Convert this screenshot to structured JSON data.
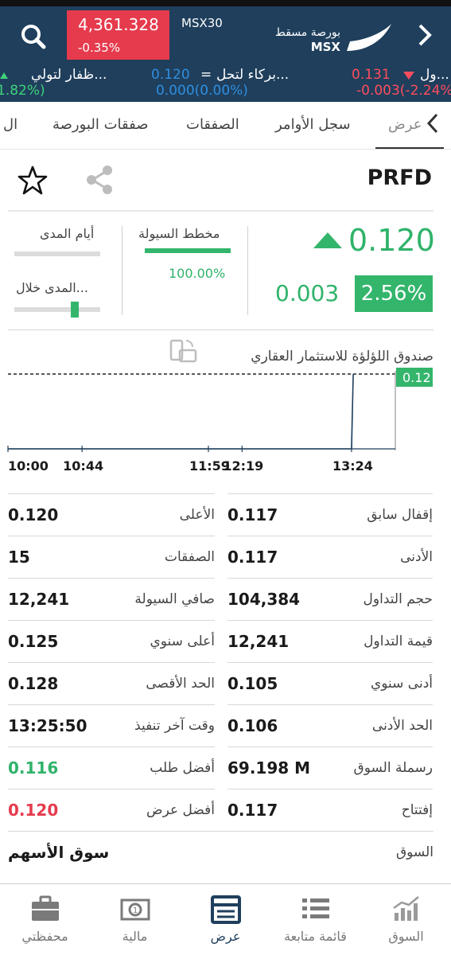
{
  "header": {
    "index_value": "4,361.328",
    "index_change": "-0.35%",
    "index_name": "MSX30",
    "exchange_name_ar": "بورصة مسقط",
    "exchange_code": "MSX",
    "icons": [
      "search-icon",
      "msx-logo",
      "chevron-right-icon"
    ]
  },
  "ticker": [
    {
      "name": "ظفار لتولي...",
      "change": "1.82%)",
      "color": "#3fd27a",
      "direction": "up"
    },
    {
      "name": "بركاء لتحل...",
      "price": "0.120",
      "mark": "=",
      "change": "0.000(0.00%)",
      "color": "#2f8fe0"
    },
    {
      "name": "ول...",
      "price": "0.131",
      "change": "-0.003(-2.24%",
      "color": "#ff4d5e",
      "direction": "down"
    }
  ],
  "tabs": [
    {
      "label": "عرض",
      "active": true
    },
    {
      "label": "سجل الأوامر"
    },
    {
      "label": "الصفقات"
    },
    {
      "label": "صفقات البورصة"
    },
    {
      "label": "ال"
    }
  ],
  "stock": {
    "symbol": "PRFD",
    "price": "0.120",
    "change": "0.003",
    "change_pct": "2.56%",
    "liquidity_label": "مخطط السيولة",
    "liquidity_value": "100.00%",
    "liquidity_level": 1.0,
    "range_days_label": "أيام المدى",
    "range_during_label": "المدى خلال...",
    "range_during_level": 0.7,
    "company_name": "صندوق اللؤلؤة للاستثمار العقاري"
  },
  "chart_data": {
    "type": "area",
    "x_ticks": [
      "10:00",
      "10:44",
      "11:59",
      "12:19",
      "13:24"
    ],
    "last_price_label": "0.12",
    "series": [
      {
        "x": [
          "10:00",
          "13:24",
          "13:25"
        ],
        "y": [
          0.117,
          0.117,
          0.12
        ]
      }
    ],
    "reference_line": 0.12
  },
  "stats": {
    "right": [
      {
        "label": "إقفال سابق",
        "value": "0.117"
      },
      {
        "label": "الأدنى",
        "value": "0.117"
      },
      {
        "label": "حجم التداول",
        "value": "104,384"
      },
      {
        "label": "قيمة التداول",
        "value": "12,241"
      },
      {
        "label": "أدنى سنوي",
        "value": "0.105"
      },
      {
        "label": "الحد الأدنى",
        "value": "0.106"
      },
      {
        "label": "رسملة السوق",
        "value": "69.198 M"
      },
      {
        "label": "إفتتاح",
        "value": "0.117"
      }
    ],
    "left": [
      {
        "label": "الأعلى",
        "value": "0.120"
      },
      {
        "label": "الصفقات",
        "value": "15"
      },
      {
        "label": "صافي السيولة",
        "value": "12,241"
      },
      {
        "label": "أعلى سنوي",
        "value": "0.125"
      },
      {
        "label": "الحد الأقصى",
        "value": "0.128"
      },
      {
        "label": "وقت آخر تنفيذ",
        "value": "13:25:50"
      },
      {
        "label": "أفضل طلب",
        "value": "0.116",
        "color": "#2fb36a"
      },
      {
        "label": "أفضل عرض",
        "value": "0.120",
        "color": "#e53b4d"
      }
    ],
    "market_label": "السوق",
    "market_value": "سوق الأسهم"
  },
  "bottom_nav": [
    {
      "label": "محفظتي",
      "icon": "briefcase-icon"
    },
    {
      "label": "مالية",
      "icon": "money-icon"
    },
    {
      "label": "عرض",
      "icon": "view-icon",
      "active": true
    },
    {
      "label": "قائمة متابعة",
      "icon": "watchlist-icon"
    },
    {
      "label": "السوق",
      "icon": "market-chart-icon"
    }
  ]
}
